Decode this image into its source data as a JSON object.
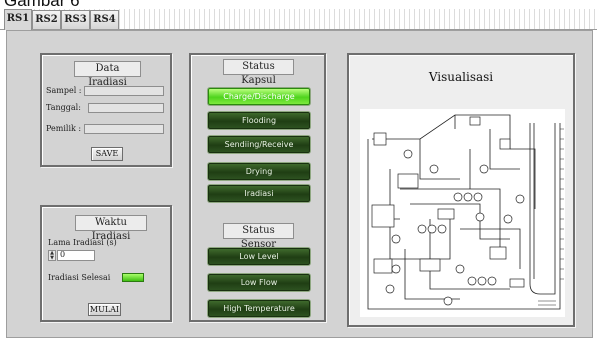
{
  "caption": "Gambar 6",
  "tabs": [
    {
      "label": "RS1",
      "active": true
    },
    {
      "label": "RS2",
      "active": false
    },
    {
      "label": "RS3",
      "active": false
    },
    {
      "label": "RS4",
      "active": false
    }
  ],
  "data_iradiasi": {
    "title": "Data Iradiasi",
    "fields": [
      {
        "label": "Sampel",
        "value": ""
      },
      {
        "label": "Tanggal",
        "value": ""
      },
      {
        "label": "Pemilik",
        "value": ""
      }
    ],
    "save_label": "SAVE"
  },
  "waktu_iradiasi": {
    "title": "Waktu Iradiasi",
    "lama_label": "Lama Iradiasi (s)",
    "lama_value": "0",
    "selesai_label": "Iradiasi Selesai",
    "mulai_label": "MULAI"
  },
  "status_kapsul": {
    "title": "Status Kapsul",
    "items": [
      {
        "label": "Charge/Discharge",
        "on": true
      },
      {
        "label": "Flooding",
        "on": false
      },
      {
        "label": "Sendiing/Receive",
        "on": false
      },
      {
        "label": "Drying",
        "on": false
      },
      {
        "label": "Iradiasi",
        "on": false
      }
    ]
  },
  "status_sensor": {
    "title": "Status Sensor",
    "items": [
      {
        "label": "Low Level",
        "on": false
      },
      {
        "label": "Low Flow",
        "on": false
      },
      {
        "label": "High Temperature",
        "on": false
      }
    ]
  },
  "visualisasi": {
    "title": "Visualisasi"
  },
  "colors": {
    "led_on": "#5fdc22",
    "led_off": "#1f3e14",
    "panel_bg": "#d3d3d3"
  }
}
